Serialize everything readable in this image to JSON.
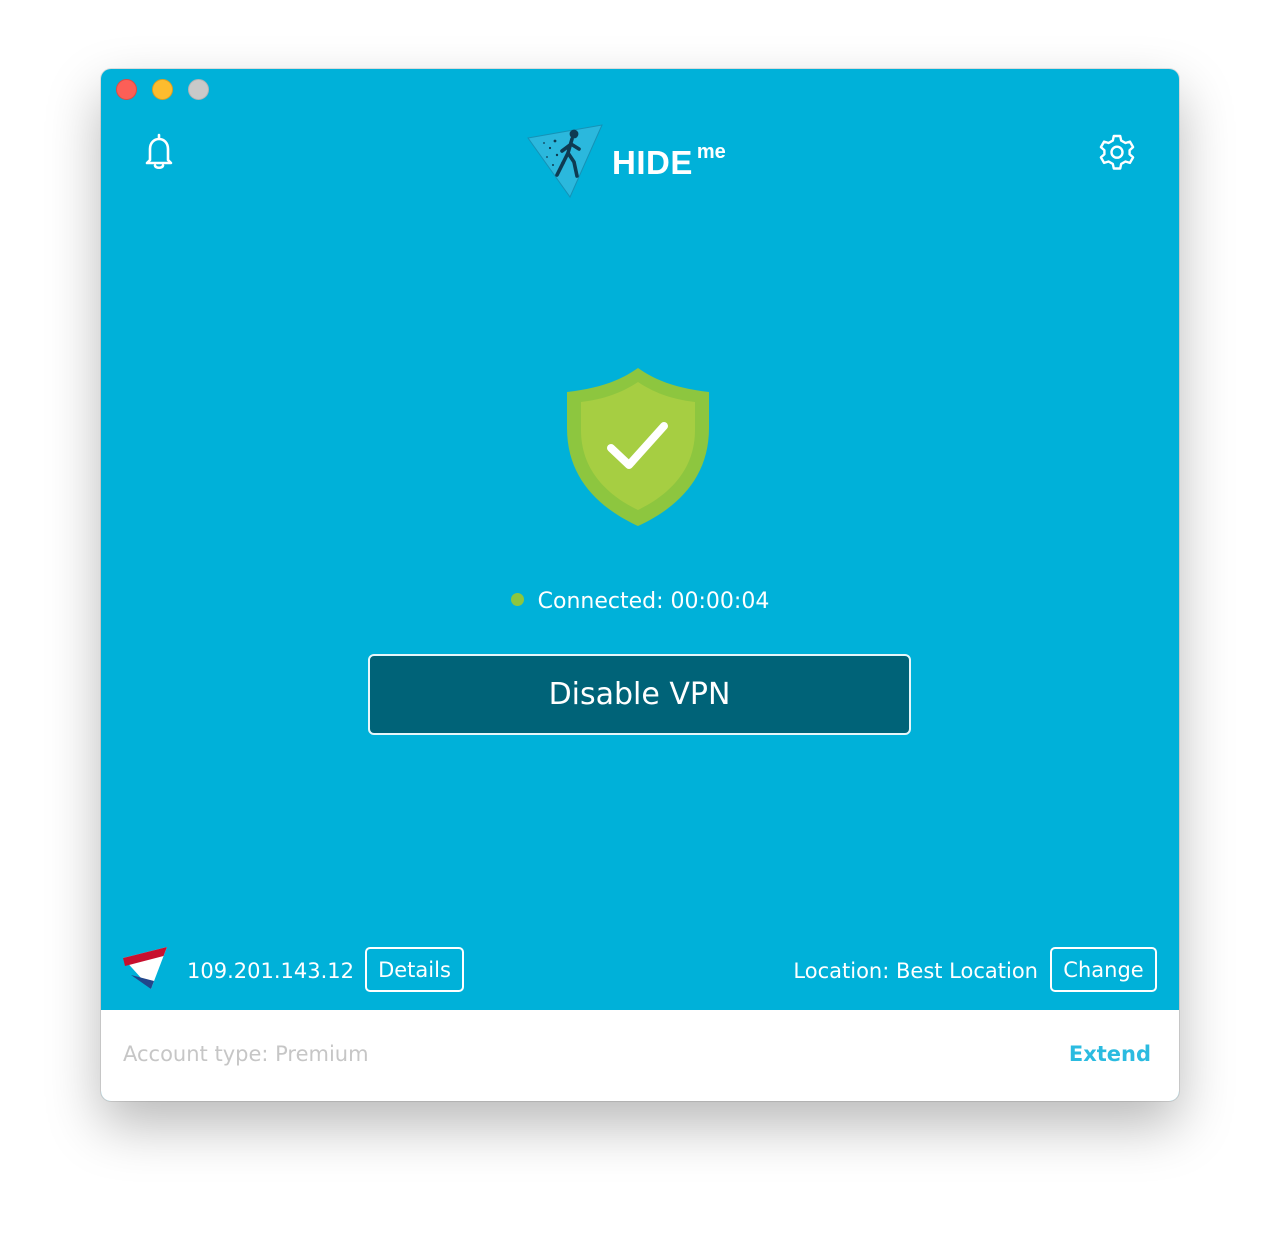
{
  "app": {
    "brand": "HIDE",
    "brand_sup": "me"
  },
  "status": {
    "connected_text": "Connected: 00:00:04",
    "state_color": "#8dc63f"
  },
  "main": {
    "disable_label": "Disable VPN"
  },
  "connection": {
    "ip": "109.201.143.12",
    "details_label": "Details",
    "location_text": "Location: Best Location",
    "change_label": "Change",
    "flag": "netherlands-flag"
  },
  "footer": {
    "account_text": "Account type: Premium",
    "extend_label": "Extend"
  },
  "icons": {
    "notifications": "bell-icon",
    "settings": "gear-icon",
    "protected": "shield-check-icon"
  },
  "colors": {
    "background": "#00b1d9",
    "button": "#006378",
    "accent": "#2bbbe0"
  }
}
